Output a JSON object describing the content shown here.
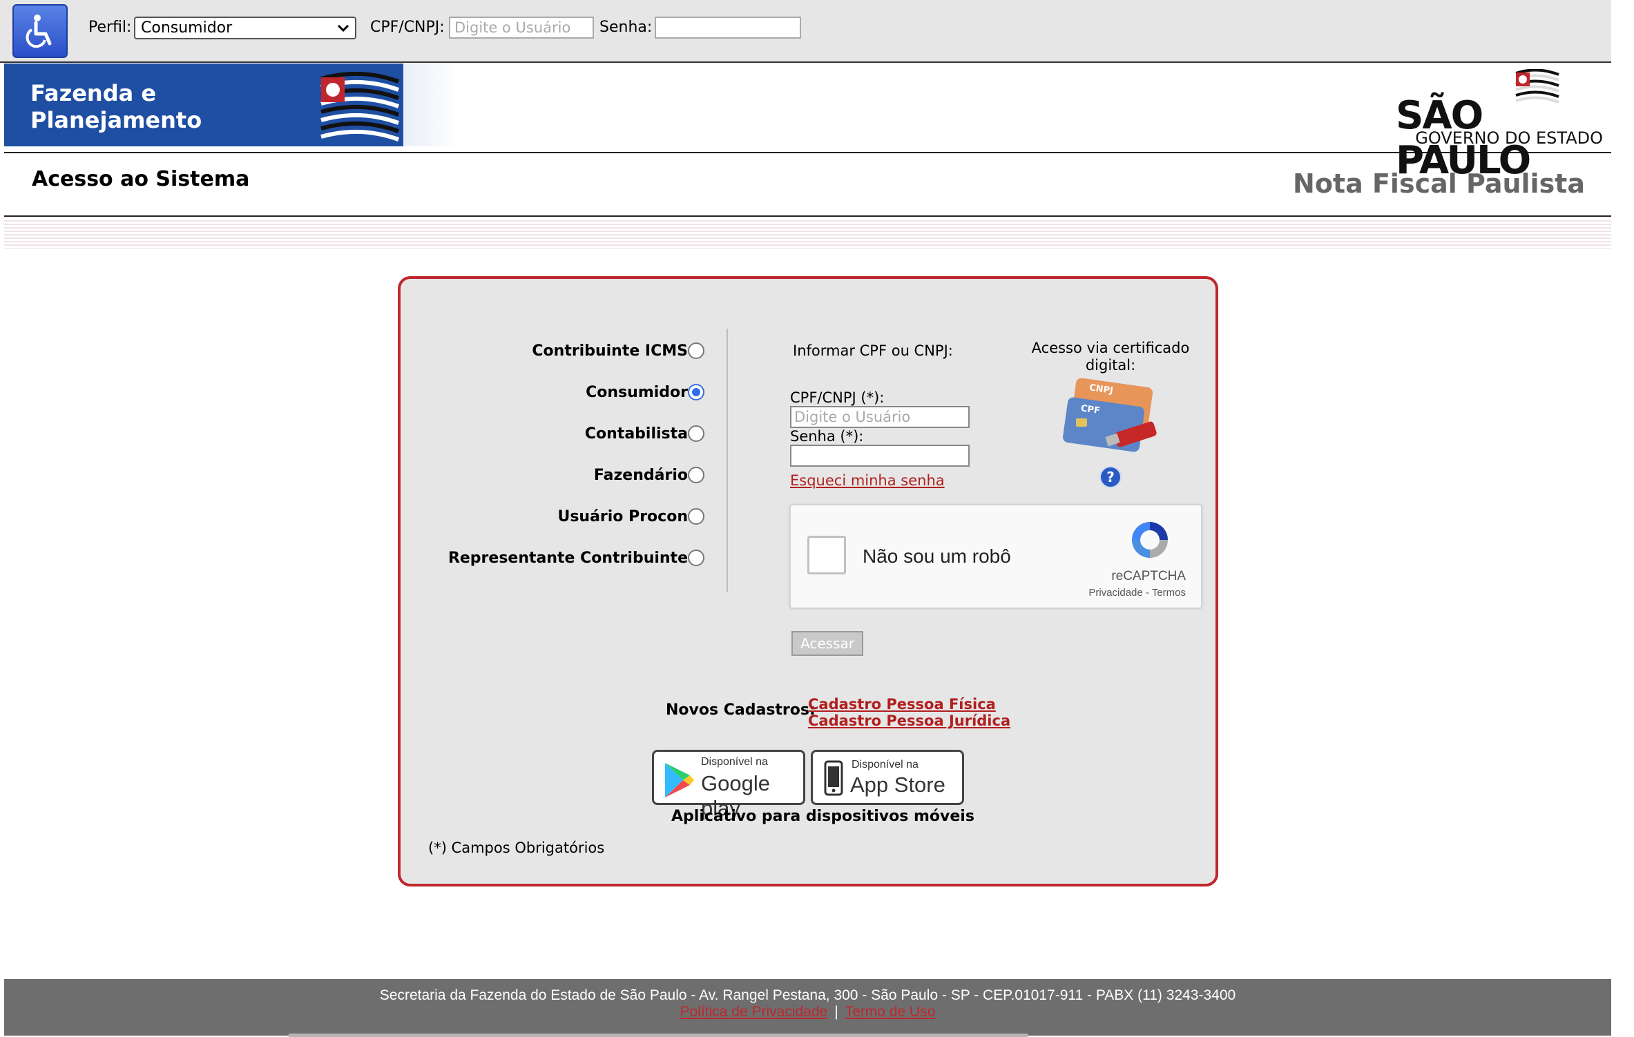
{
  "topbar": {
    "perfil_label": "Perfil:",
    "perfil_value": "Consumidor",
    "cpf_label": "CPF/CNPJ:",
    "cpf_placeholder": "Digite o Usuário",
    "senha_label": "Senha:"
  },
  "banner": {
    "fazenda_line1": "Fazenda e",
    "fazenda_line2": "Planejamento",
    "sp_line1": "SÃO PAULO",
    "sp_line2": "GOVERNO DO ESTADO"
  },
  "titles": {
    "page_title": "Acesso ao Sistema",
    "system_title": "Nota Fiscal Paulista"
  },
  "profiles": [
    {
      "label": "Contribuinte ICMS",
      "checked": false
    },
    {
      "label": "Consumidor",
      "checked": true
    },
    {
      "label": "Contabilista",
      "checked": false
    },
    {
      "label": "Fazendário",
      "checked": false
    },
    {
      "label": "Usuário Procon",
      "checked": false
    },
    {
      "label": "Representante Contribuinte",
      "checked": false
    }
  ],
  "login": {
    "heading": "Informar CPF ou CNPJ:",
    "cpf_label": "CPF/CNPJ (*):",
    "cpf_placeholder": "Digite o Usuário",
    "senha_label": "Senha (*):",
    "forgot_link": "Esqueci minha senha",
    "submit_label": "Acessar"
  },
  "certificate": {
    "label": "Acesso via certificado digital:",
    "card_cnpj": "CNPJ",
    "card_cpf": "CPF"
  },
  "recaptcha": {
    "label": "Não sou um robô",
    "brand": "reCAPTCHA",
    "privacy": "Privacidade",
    "terms": "Termos"
  },
  "registration": {
    "label": "Novos Cadastros:",
    "pf_link": "Cadastro Pessoa Física",
    "pj_link": "Cadastro Pessoa Jurídica"
  },
  "apps": {
    "google_small": "Disponível na",
    "google_big": "Google play",
    "apple_small": "Disponível na",
    "apple_big": "App Store",
    "caption": "Aplicativo para dispositivos móveis"
  },
  "required_note": "(*) Campos Obrigatórios",
  "footer": {
    "address": "Secretaria da Fazenda do Estado de São Paulo - Av. Rangel Pestana, 300 - São Paulo - SP - CEP.01017-911 - PABX (11) 3243-3400",
    "privacy_link": "Política de Privacidade",
    "separator": "|",
    "terms_link": "Termo de Uso"
  },
  "colors": {
    "accent_red": "#c0262d",
    "brand_blue": "#1f4fa3",
    "panel_bg": "#e6e6e6",
    "footer_bg": "#6e6e6e"
  }
}
